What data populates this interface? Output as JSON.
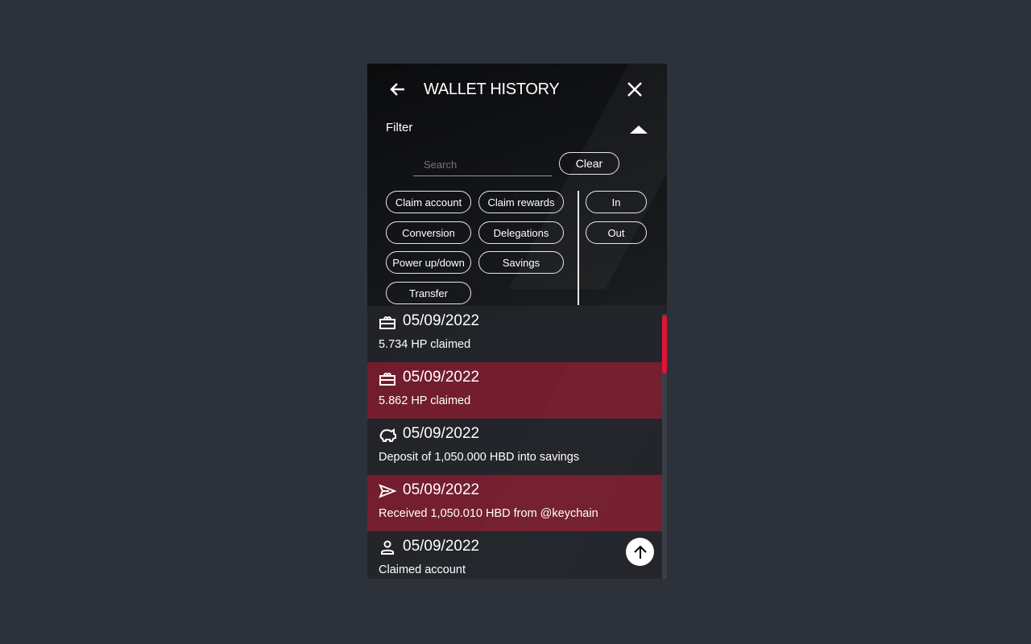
{
  "header": {
    "title": "WALLET HISTORY",
    "back_icon": "arrow-left-icon",
    "close_icon": "close-icon"
  },
  "filter": {
    "label": "Filter",
    "toggle_icon": "triangle-up-icon",
    "search_placeholder": "Search",
    "search_value": "",
    "clear_label": "Clear",
    "types": [
      "Claim account",
      "Claim rewards",
      "Conversion",
      "Delegations",
      "Power up/down",
      "Savings",
      "Transfer"
    ],
    "directions": [
      "In",
      "Out"
    ]
  },
  "transactions": [
    {
      "icon": "gift-icon",
      "date": "05/09/2022",
      "description": "5.734 HP claimed",
      "highlight": false
    },
    {
      "icon": "gift-icon",
      "date": "05/09/2022",
      "description": "5.862 HP claimed",
      "highlight": true
    },
    {
      "icon": "piggy-bank-icon",
      "date": "05/09/2022",
      "description": "Deposit of 1,050.000 HBD into savings",
      "highlight": false
    },
    {
      "icon": "send-icon",
      "date": "05/09/2022",
      "description": "Received 1,050.010 HBD from @keychain",
      "highlight": true
    },
    {
      "icon": "user-icon",
      "date": "05/09/2022",
      "description": "Claimed account",
      "highlight": false
    }
  ],
  "scroll_top_icon": "arrow-up-icon",
  "colors": {
    "highlight": "#8c1e32",
    "scroll_thumb": "#e31337",
    "background": "#2d323a"
  }
}
